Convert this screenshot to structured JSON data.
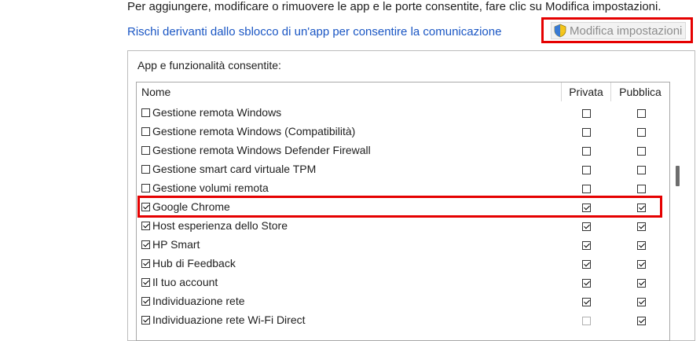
{
  "intro_text": "Per aggiungere, modificare o rimuovere le app e le porte consentite, fare clic su Modifica impostazioni.",
  "risk_link": "Rischi derivanti dallo sblocco di un'app per consentire la comunicazione",
  "modify_button": {
    "label": "Modifica impostazioni",
    "icon": "uac-shield-icon"
  },
  "group_label": "App e funzionalità consentite:",
  "columns": {
    "name": "Nome",
    "private": "Privata",
    "public": "Pubblica"
  },
  "apps": [
    {
      "name": "Gestione remota Windows",
      "enabled": false,
      "private": false,
      "public": false
    },
    {
      "name": "Gestione remota Windows (Compatibilità)",
      "enabled": false,
      "private": false,
      "public": false
    },
    {
      "name": "Gestione remota Windows Defender Firewall",
      "enabled": false,
      "private": false,
      "public": false
    },
    {
      "name": "Gestione smart card virtuale TPM",
      "enabled": false,
      "private": false,
      "public": false
    },
    {
      "name": "Gestione volumi remota",
      "enabled": false,
      "private": false,
      "public": false
    },
    {
      "name": "Google Chrome",
      "enabled": true,
      "private": true,
      "public": true
    },
    {
      "name": "Host esperienza dello Store",
      "enabled": true,
      "private": true,
      "public": true
    },
    {
      "name": "HP Smart",
      "enabled": true,
      "private": true,
      "public": true
    },
    {
      "name": "Hub di Feedback",
      "enabled": true,
      "private": true,
      "public": true
    },
    {
      "name": "Il tuo account",
      "enabled": true,
      "private": true,
      "public": true
    },
    {
      "name": "Individuazione rete",
      "enabled": true,
      "private": true,
      "public": true
    },
    {
      "name": "Individuazione rete Wi-Fi Direct",
      "enabled": true,
      "private": false,
      "public": true
    }
  ],
  "colors": {
    "link": "#1a56c4",
    "highlight": "#e50000"
  }
}
